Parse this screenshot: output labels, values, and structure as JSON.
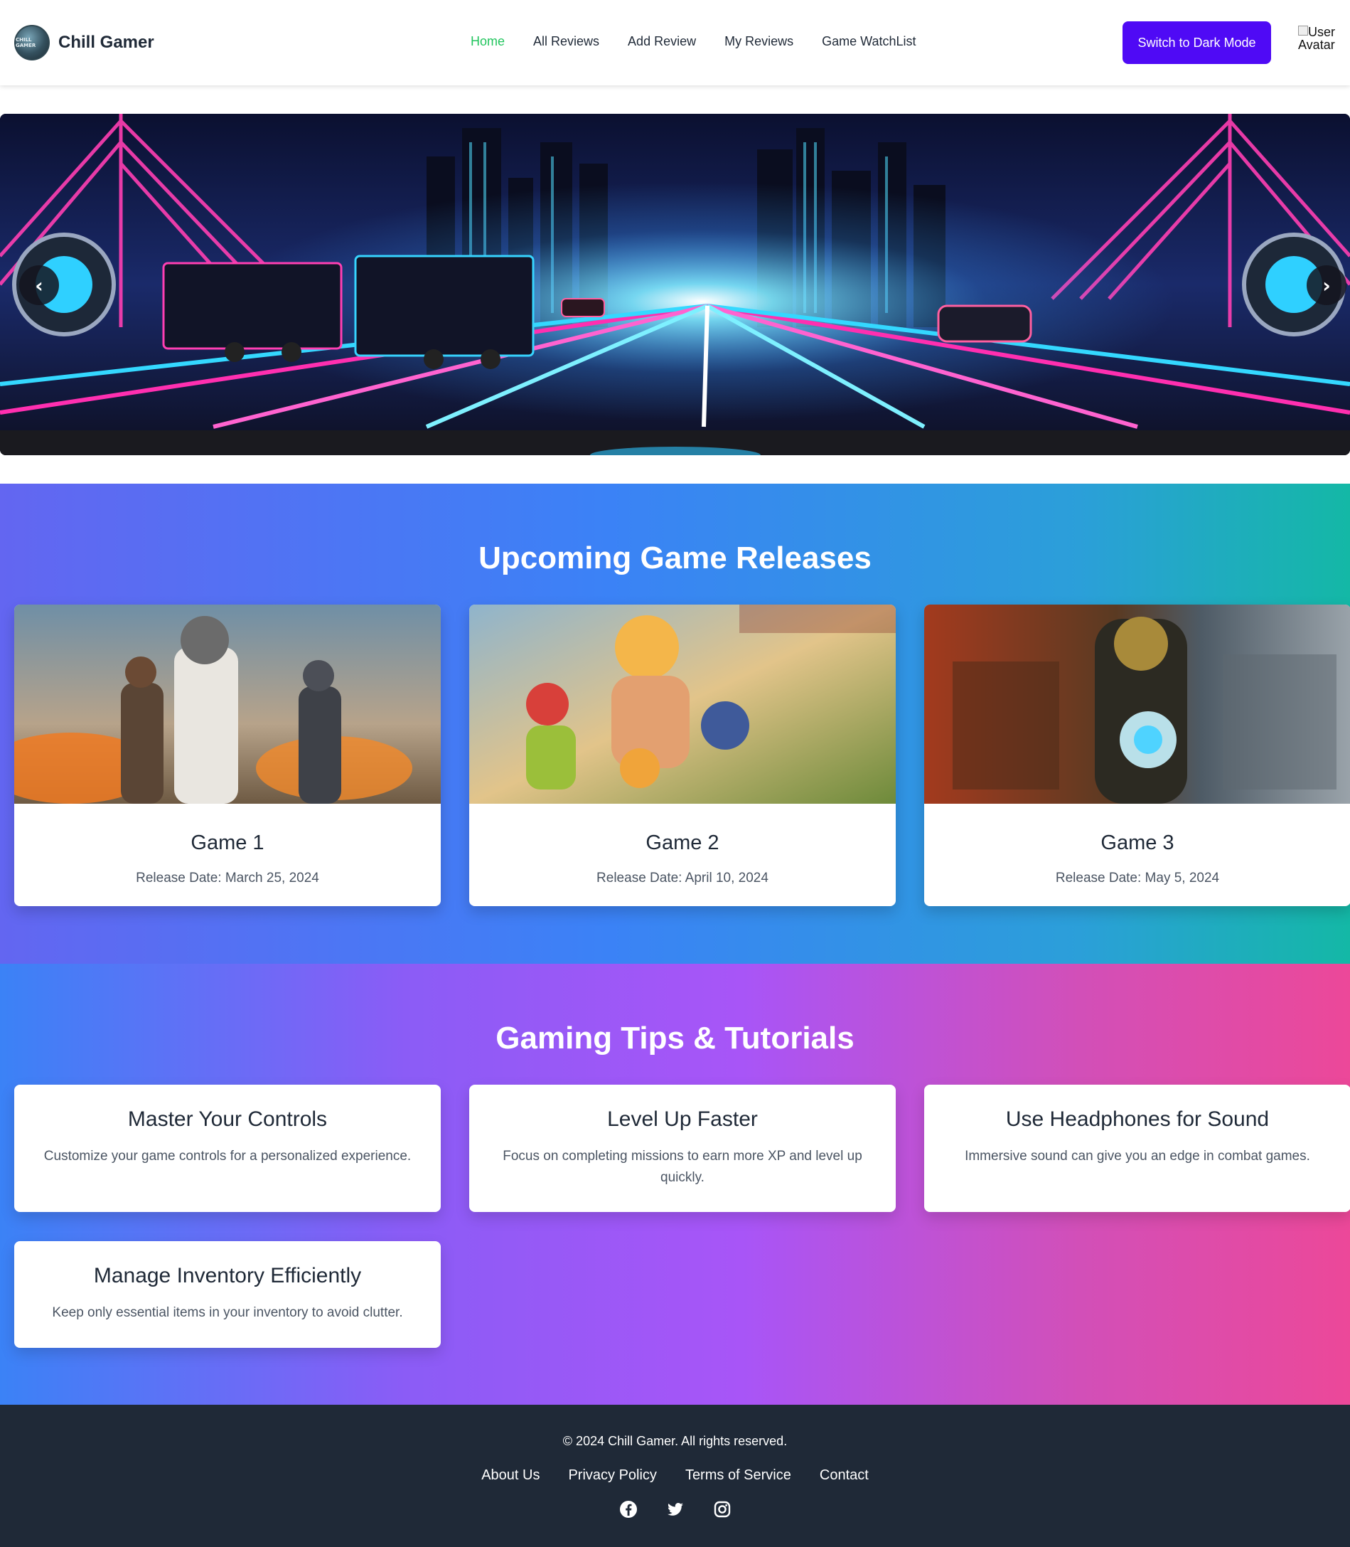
{
  "brand": {
    "name": "Chill Gamer",
    "logo_text": "CHILL GAMER"
  },
  "nav": {
    "links": [
      "Home",
      "All Reviews",
      "Add Review",
      "My Reviews",
      "Game WatchList"
    ],
    "active": "Home"
  },
  "mode_button": "Switch to Dark Mode",
  "avatar_alt": "User Avatar",
  "slider": {
    "prev_icon": "‹",
    "next_icon": "›"
  },
  "upcoming": {
    "title": "Upcoming Game Releases",
    "games": [
      {
        "name": "Game 1",
        "release": "Release Date: March 25, 2024"
      },
      {
        "name": "Game 2",
        "release": "Release Date: April 10, 2024"
      },
      {
        "name": "Game 3",
        "release": "Release Date: May 5, 2024"
      }
    ]
  },
  "tips": {
    "title": "Gaming Tips & Tutorials",
    "items": [
      {
        "title": "Master Your Controls",
        "desc": "Customize your game controls for a personalized experience."
      },
      {
        "title": "Level Up Faster",
        "desc": "Focus on completing missions to earn more XP and level up quickly."
      },
      {
        "title": "Use Headphones for Sound",
        "desc": "Immersive sound can give you an edge in combat games."
      },
      {
        "title": "Manage Inventory Efficiently",
        "desc": "Keep only essential items in your inventory to avoid clutter."
      }
    ]
  },
  "footer": {
    "copyright": "© 2024 Chill Gamer. All rights reserved.",
    "links": [
      "About Us",
      "Privacy Policy",
      "Terms of Service",
      "Contact"
    ],
    "socials": [
      "facebook-icon",
      "twitter-icon",
      "instagram-icon"
    ]
  },
  "colors": {
    "accent": "#4f0af5",
    "active_link": "#22c55e",
    "footer_bg": "#1f2937"
  }
}
